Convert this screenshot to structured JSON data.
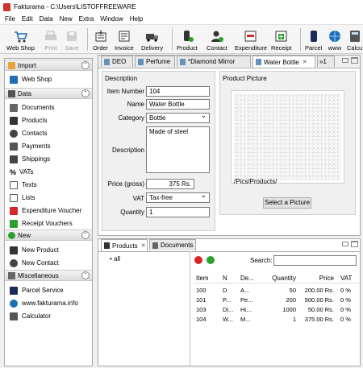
{
  "window": {
    "title": "Fakturama - C:\\Users\\LISTOFFREEWARE"
  },
  "menu": [
    "File",
    "Edit",
    "Data",
    "New",
    "Extra",
    "Window",
    "Help"
  ],
  "toolbar": [
    {
      "label": "Web Shop",
      "icon": "web-shop-icon"
    },
    {
      "label": "Print",
      "icon": "print-icon",
      "disabled": true
    },
    {
      "label": "Save",
      "icon": "save-icon",
      "disabled": true
    },
    {
      "label": "Order",
      "icon": "order-icon"
    },
    {
      "label": "Invoice",
      "icon": "invoice-icon"
    },
    {
      "label": "Delivery",
      "icon": "delivery-icon"
    },
    {
      "label": "Product",
      "icon": "product-icon"
    },
    {
      "label": "Contact",
      "icon": "contact-icon"
    },
    {
      "label": "Expenditure",
      "icon": "expenditure-icon"
    },
    {
      "label": "Receipt",
      "icon": "receipt-icon"
    },
    {
      "label": "Parcel",
      "icon": "parcel-icon"
    },
    {
      "label": "www",
      "icon": "www-icon"
    },
    {
      "label": "Calcu",
      "icon": "calculator-icon"
    }
  ],
  "sidebar": {
    "sections": [
      {
        "title": "Import",
        "items": [
          "Web Shop"
        ]
      },
      {
        "title": "Data",
        "items": [
          "Documents",
          "Products",
          "Contacts",
          "Payments",
          "Shippings",
          "VATs",
          "Texts",
          "Lists",
          "Expenditure Voucher",
          "Receipt Vouchers"
        ]
      },
      {
        "title": "New",
        "items": [
          "New Product",
          "New Contact"
        ]
      },
      {
        "title": "Miscellaneous",
        "items": [
          "Parcel Service",
          "www.fakturama.info",
          "Calculator"
        ]
      }
    ]
  },
  "editor_tabs": [
    "DEO",
    "Perfume",
    "*Diamond Mirror",
    "Water Bottle",
    "»1"
  ],
  "form": {
    "description_group": "Description",
    "item_number_label": "Item Number",
    "item_number": "104",
    "name_label": "Name",
    "name": "Water Bottle",
    "category_label": "Category",
    "category": "Bottle",
    "description_label": "Description",
    "description": "Made of steel",
    "price_label": "Price (gross)",
    "price": "375 Rs.",
    "vat_label": "VAT",
    "vat": "Tax-free",
    "quantity_label": "Quantity",
    "quantity": "1",
    "picture_group": "Product Picture",
    "picture_path": "/Pics/Products/",
    "select_picture": "Select a Picture"
  },
  "bottom_tabs": [
    "Products",
    "Documents"
  ],
  "tree": {
    "root": "all"
  },
  "search_label": "Search:",
  "table": {
    "headers": [
      "Item",
      "N",
      "De...",
      "Quantity",
      "Price",
      "VAT"
    ],
    "rows": [
      [
        "100",
        "D",
        "A...",
        "50",
        "200.00 Rs.",
        "0 %"
      ],
      [
        "101",
        "P...",
        "Pe...",
        "200",
        "500.00 Rs.",
        "0 %"
      ],
      [
        "103",
        "Di...",
        "Hi...",
        "1000",
        "50.00 Rs.",
        "0 %"
      ],
      [
        "104",
        "W...",
        "M...",
        "1",
        "375.00 Rs.",
        "0 %"
      ]
    ]
  }
}
